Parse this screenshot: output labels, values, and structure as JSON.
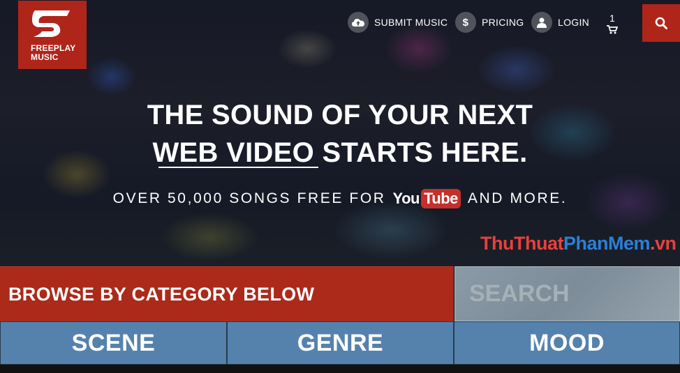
{
  "brand": {
    "logo_text_line1": "FREEPLAY",
    "logo_text_line2": "MUSIC",
    "color": "#b0251a"
  },
  "nav": {
    "submit_label": "SUBMIT MUSIC",
    "submit_icon": "cloud-upload-icon",
    "pricing_label": "PRICING",
    "pricing_icon": "dollar-icon",
    "login_label": "LOGIN",
    "login_icon": "user-icon",
    "cart_count": "1",
    "cart_icon": "cart-icon",
    "search_icon": "search-icon"
  },
  "hero": {
    "headline_line1": "THE SOUND OF YOUR NEXT",
    "headline_line2_underlined": "WEB VIDEO",
    "headline_line2_rest": " STARTS HERE.",
    "subline_before": "OVER 50,000 SONGS FREE FOR",
    "youtube_you": "You",
    "youtube_tube": "Tube",
    "subline_after": "AND MORE."
  },
  "watermark": {
    "part1": "ThuThuat",
    "part2": "PhanMem",
    "part3": ".vn"
  },
  "browse": {
    "label": "BROWSE BY CATEGORY BELOW",
    "search_placeholder": "SEARCH"
  },
  "categories": [
    {
      "label": "SCENE"
    },
    {
      "label": "GENRE"
    },
    {
      "label": "MOOD"
    }
  ],
  "colors": {
    "accent_red": "#ab2a1a",
    "category_blue": "#5582ad"
  }
}
